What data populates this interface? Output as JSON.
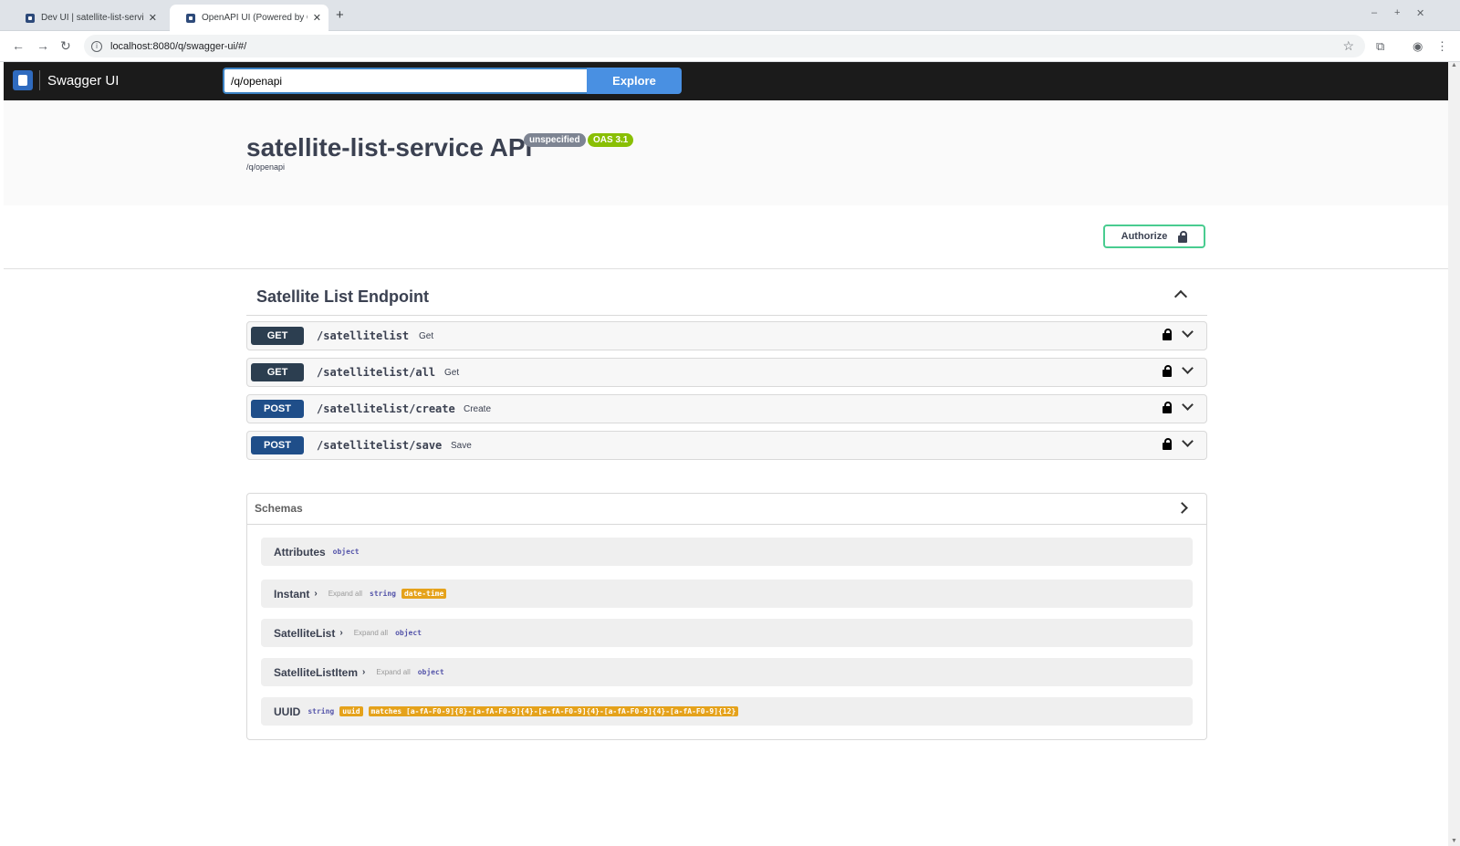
{
  "browser": {
    "tabs": [
      {
        "title": "Dev UI | satellite-list-service",
        "active": false
      },
      {
        "title": "OpenAPI UI (Powered by Qu",
        "active": true
      }
    ],
    "address": "localhost:8080/q/swagger-ui/#/",
    "icons": [
      "back-arrow-icon",
      "forward-arrow-icon",
      "reload-icon",
      "site-info-icon",
      "star-icon",
      "tab-search-icon",
      "profile-icon",
      "menu-icon"
    ]
  },
  "topbar": {
    "brand": "Swagger UI",
    "spec_url_value": "/q/openapi",
    "explore_label": "Explore",
    "accent": "#4990e2"
  },
  "info": {
    "title": "satellite-list-service API",
    "version_badge": "unspecified",
    "oas_badge": "OAS 3.1",
    "spec_link": "/q/openapi"
  },
  "authorize_label": "Authorize",
  "tag": {
    "name": "Satellite List Endpoint"
  },
  "operations": [
    {
      "method": "GET",
      "path": "/satellitelist",
      "summary": "Get"
    },
    {
      "method": "GET",
      "path": "/satellitelist/all",
      "summary": "Get"
    },
    {
      "method": "POST",
      "path": "/satellitelist/create",
      "summary": "Create"
    },
    {
      "method": "POST",
      "path": "/satellitelist/save",
      "summary": "Save"
    }
  ],
  "schemas": {
    "title": "Schemas",
    "models": [
      {
        "name": "Attributes",
        "type": "object"
      },
      {
        "name": "Instant",
        "expand": "Expand all",
        "type": "string",
        "format": "date-time"
      },
      {
        "name": "SatelliteList",
        "expand": "Expand all",
        "type": "object"
      },
      {
        "name": "SatelliteListItem",
        "expand": "Expand all",
        "type": "object"
      },
      {
        "name": "UUID",
        "type": "string",
        "format": "uuid",
        "pattern": "matches [a-fA-F0-9]{8}-[a-fA-F0-9]{4}-[a-fA-F0-9]{4}-[a-fA-F0-9]{4}-[a-fA-F0-9]{12}"
      }
    ]
  },
  "colors": {
    "get": "#2c3e50",
    "post": "#1f4e89",
    "oas_badge": "#89bf04",
    "version_badge": "#7d8492",
    "format_tag": "#e5a21b"
  }
}
